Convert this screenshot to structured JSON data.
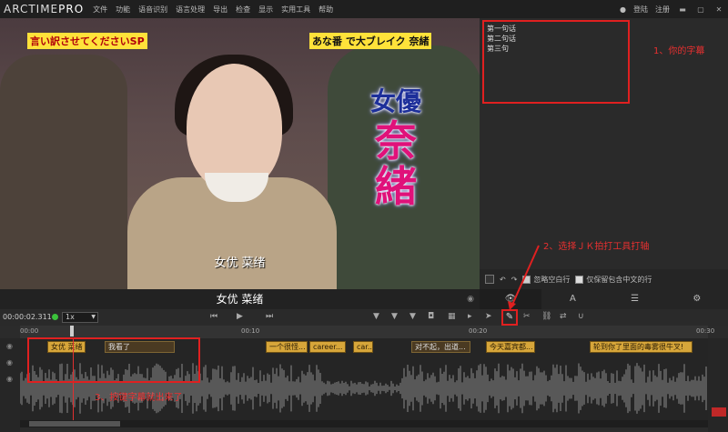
{
  "app": {
    "logo_main": "ARCTIME",
    "logo_pro": "PRO"
  },
  "menu": [
    "文件",
    "功能",
    "语音识别",
    "语言处理",
    "导出",
    "检查",
    "显示",
    "实用工具",
    "帮助"
  ],
  "auth": {
    "login": "登陆",
    "register": "注册"
  },
  "window": {
    "min": "▬",
    "max": "▢",
    "close": "✕"
  },
  "video": {
    "banner_left": "言い訳させてくださいSP",
    "banner_right": "あな番 で大ブレイク 奈緒",
    "caption_top": "女優",
    "caption_big": "奈緒",
    "subtitle": "女优 菜绪"
  },
  "script": {
    "lines": [
      "第一句话",
      "第二句话",
      "第三句"
    ]
  },
  "annotations": {
    "a1": "1、你的字幕",
    "a2": "2、选择ＪＫ拍打工具打轴",
    "a3": "3、按键字幕就出来了"
  },
  "side_toolbar": {
    "ignore_blank": "忽略空白行",
    "keep_chinese": "仅保留包含中文的行"
  },
  "sub_row": {
    "text": "女优 菜绪"
  },
  "side_tabs": [
    "👁",
    "A",
    "☰",
    "⚙"
  ],
  "transport": {
    "timecode": "00:00:02.311",
    "speed": "1x"
  },
  "ruler": {
    "t1": "00:00",
    "t2": "00:10",
    "t3": "00:20",
    "t4": "00:30"
  },
  "clips": [
    {
      "label": "女优 菜绪",
      "dark": false
    },
    {
      "label": "我看了",
      "dark": true
    },
    {
      "label": "一个很怪...",
      "dark": false
    },
    {
      "label": "career...",
      "dark": false
    },
    {
      "label": "car...",
      "dark": false
    },
    {
      "label": "对不起，出道...",
      "dark": true
    },
    {
      "label": "今天嘉宾都...",
      "dark": false
    },
    {
      "label": "轮到你了里面的毒雾很牛叉!",
      "dark": false
    }
  ]
}
